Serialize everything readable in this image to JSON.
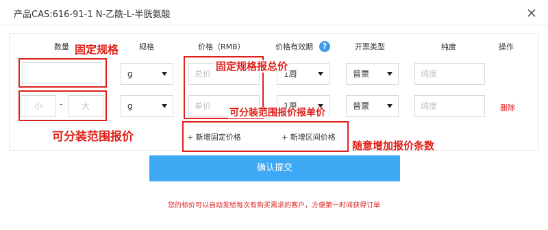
{
  "dialog": {
    "title": "产品CAS:616-91-1 N-乙酰-L-半胱氨酸",
    "close_icon": "close-icon"
  },
  "columns": {
    "quantity": "数量",
    "spec": "规格",
    "price": "价格（RMB）",
    "validity": "价格有效期",
    "invoice": "开票类型",
    "purity": "纯度",
    "action": "操作",
    "help_icon_label": "?"
  },
  "row_fixed": {
    "quantity_value": "",
    "spec_value": "g",
    "price_placeholder": "总价",
    "validity_value": "1周",
    "invoice_value": "普票",
    "purity_placeholder": "纯度"
  },
  "row_range": {
    "min_placeholder": "小",
    "separator": "-",
    "max_placeholder": "大",
    "spec_value": "g",
    "price_placeholder": "单价",
    "validity_value": "1周",
    "invoice_value": "普票",
    "purity_placeholder": "纯度",
    "delete_label": "删除"
  },
  "actions": {
    "add_fixed": "+ 新增固定价格",
    "add_range": "+ 新增区间价格",
    "submit": "确认提交"
  },
  "note": "您的标价可以自动发给每次有购买需求的客户，方便第一时间获得订单",
  "annotations": {
    "fixed_spec": "固定规格",
    "fixed_spec_total": "固定规格报总价",
    "range_unit": "可分装范围报价报单价",
    "range_price": "可分装范围报价",
    "add_more": "随意增加报价条数"
  },
  "colors": {
    "accent": "#3fa8f4",
    "annotation_red": "#e0201a",
    "delete_red": "#e02020"
  }
}
